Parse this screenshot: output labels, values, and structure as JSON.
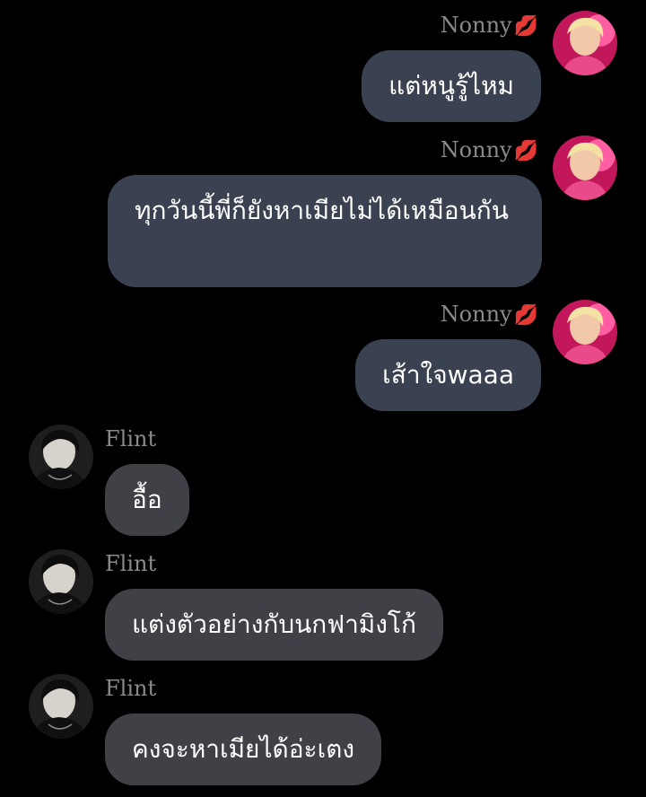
{
  "chat": {
    "messages": [
      {
        "sender": "Nonny",
        "text": "แต่หนูรู้ไหม"
      },
      {
        "sender": "Nonny",
        "text": "ทุกวันนี้พี่ก็ยังหาเมียไม่ได้เหมือนกัน"
      },
      {
        "sender": "Nonny",
        "text": "เส้าใจwaaa"
      },
      {
        "sender": "Flint",
        "text": "อื้อ"
      },
      {
        "sender": "Flint",
        "text": "แต่งตัวอย่างกับนกฟามิงโก้"
      },
      {
        "sender": "Flint",
        "text": "คงจะหาเมียได้อ่ะเตง"
      }
    ],
    "sender_badge_icon": "kiss-mark-icon",
    "colors": {
      "background": "#000000",
      "outgoing_bubble": "#3a4150",
      "incoming_bubble": "#404146",
      "name_text": "#8a8a8a",
      "message_text": "#ffffff"
    }
  }
}
